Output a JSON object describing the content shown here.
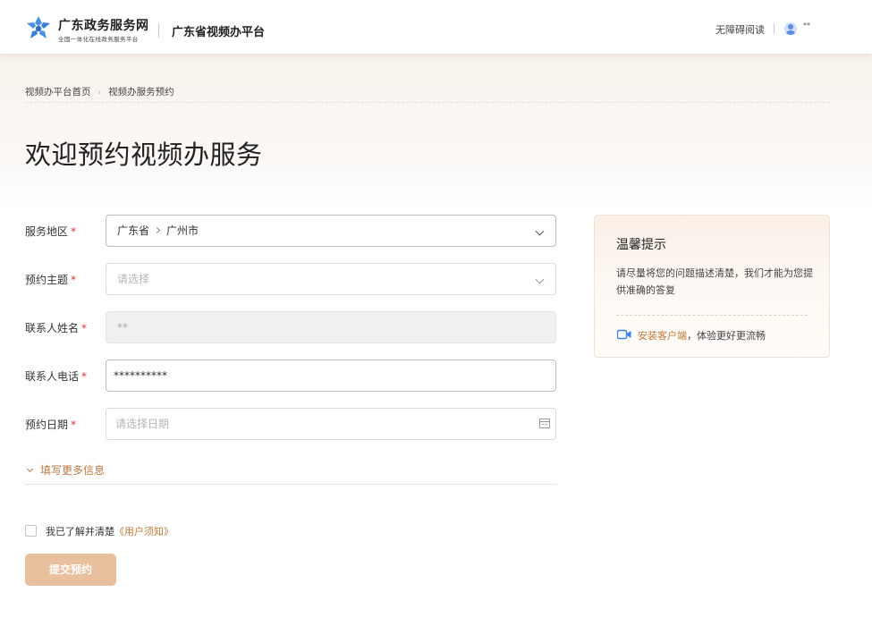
{
  "header": {
    "logo_title": "广东政务服务网",
    "logo_subtitle": "全国一体化在线政务服务平台",
    "platform_name": "广东省视频办平台",
    "accessible_label": "无障碍阅读",
    "user_name": "**",
    "brand_color": "#4a90e2"
  },
  "breadcrumb": {
    "home": "视频办平台首页",
    "current": "视频办服务预约"
  },
  "page_title": "欢迎预约视频办服务",
  "form": {
    "region": {
      "label": "服务地区",
      "province": "广东省",
      "city": "广州市"
    },
    "topic": {
      "label": "预约主题",
      "placeholder": "请选择"
    },
    "contact_name": {
      "label": "联系人姓名",
      "value": "**"
    },
    "contact_phone": {
      "label": "联系人电话",
      "value": "**********"
    },
    "date": {
      "label": "预约日期",
      "placeholder": "请选择日期"
    },
    "required_mark": "*",
    "more_info": "填写更多信息",
    "agreement_text": "我已了解并清楚",
    "agreement_link": "《用户须知》",
    "submit_label": "提交预约"
  },
  "tips": {
    "title": "温馨提示",
    "body": "请尽量将您的问题描述清楚，我们才能为您提供准确的答复",
    "install_link": "安装客户端",
    "install_suffix": "，体验更好更流畅"
  },
  "colors": {
    "accent": "#c07a3a",
    "submit_bg": "#e8c09e",
    "required": "#d9363e"
  }
}
